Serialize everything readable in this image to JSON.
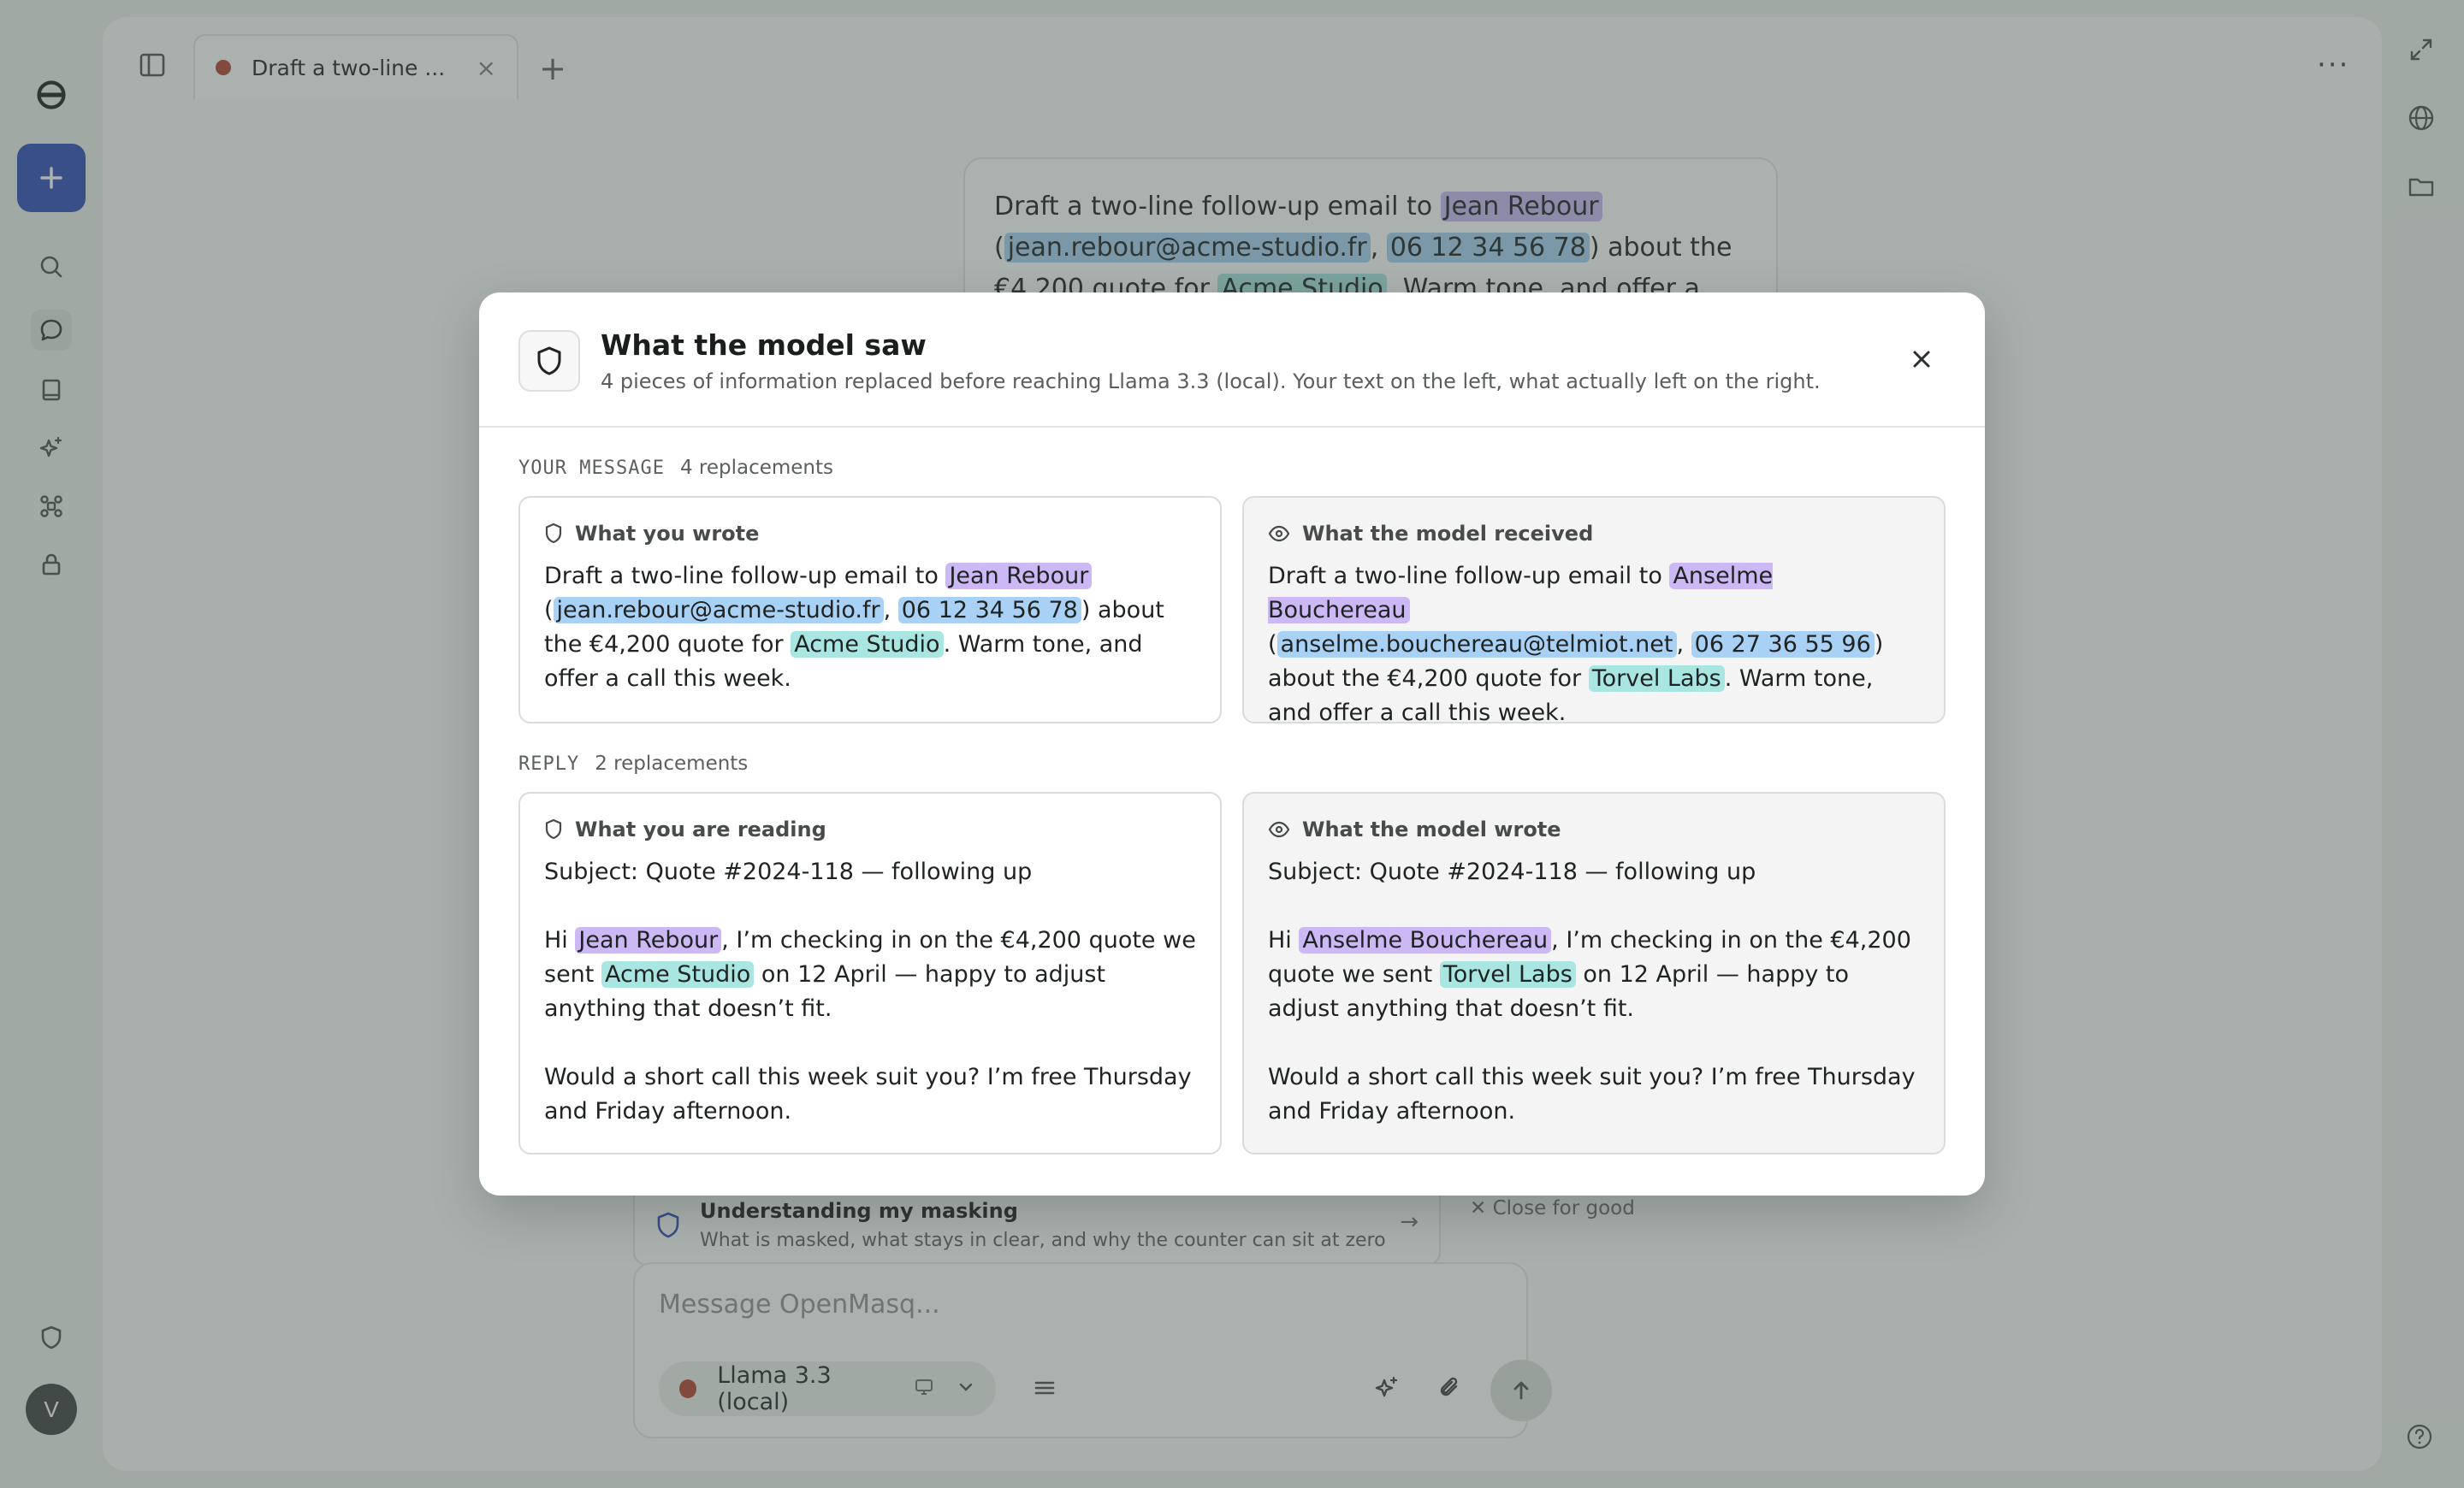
{
  "app": {
    "tab": {
      "title": "Draft a two-line ...",
      "close": "×"
    },
    "add_tab": "+",
    "more": "···",
    "avatar": "V"
  },
  "conversation": {
    "user_message": {
      "t1": "Draft a two-line follow-up email to ",
      "name": "Jean Rebour",
      "t2": "(",
      "email": "jean.rebour@acme-studio.fr",
      "comma": ", ",
      "phone": "06 12 34 56 78",
      "t3": ") about the",
      "t4": "€4,200 quote for ",
      "org": "Acme Studio",
      "t5": ". Warm tone, and offer a call"
    }
  },
  "notice": {
    "title": "Understanding my masking",
    "subtitle": "What is masked, what stays in clear, and why the counter can sit at zero",
    "arrow": "→",
    "dismiss": "✕ Close for good"
  },
  "composer": {
    "placeholder": "Message OpenMasq...",
    "model": "Llama 3.3 (local)"
  },
  "modal": {
    "title": "What the model saw",
    "subtitle": "4 pieces of information replaced before reaching Llama 3.3 (local). Your text on the left, what actually left on the right.",
    "message_section": {
      "label": "YOUR MESSAGE",
      "count": "4 replacements"
    },
    "reply_section": {
      "label": "REPLY",
      "count": "2 replacements"
    },
    "you_wrote": {
      "heading": "What you wrote",
      "t1": "Draft a two-line follow-up email to ",
      "name": "Jean Rebour",
      "t2": "(",
      "email": "jean.rebour@acme-studio.fr",
      "comma": ", ",
      "phone": "06 12 34 56 78",
      "t3": ") about the €4,200 quote for ",
      "org": "Acme Studio",
      "t4": ". Warm tone, and offer a call this week."
    },
    "model_received": {
      "heading": "What the model received",
      "t1": "Draft a two-line follow-up email to ",
      "name": "Anselme Bouchereau",
      "t2": "(",
      "email": "anselme.bouchereau@telmiot.net",
      "comma": ", ",
      "phone": "06 27 36 55 96",
      "t3": ") about the €4,200 quote for ",
      "org": "Torvel Labs",
      "t4": ". Warm tone, and offer a call this week."
    },
    "you_reading": {
      "heading": "What you are reading",
      "subject": "Subject: Quote #2024-118 — following up",
      "hi": "Hi ",
      "name": "Jean Rebour",
      "t1": ", I’m checking in on the €4,200 quote we sent ",
      "org": "Acme Studio",
      "t2": " on 12 April — happy to adjust anything that doesn’t fit.",
      "closing": "Would a short call this week suit you? I’m free Thursday and Friday afternoon."
    },
    "model_wrote": {
      "heading": "What the model wrote",
      "subject": "Subject: Quote #2024-118 — following up",
      "hi": "Hi ",
      "name": "Anselme Bouchereau",
      "t1": ", I’m checking in on the €4,200 quote we sent ",
      "org": "Torvel Labs",
      "t2": " on 12 April — happy to adjust anything that doesn’t fit.",
      "closing": "Would a short call this week suit you? I’m free Thursday and Friday afternoon."
    }
  },
  "colors": {
    "accent": "#2f4bb8",
    "name_highlight": "#cbb8f5",
    "contact_highlight": "#a8d1f5",
    "org_highlight": "#a9e6e1"
  },
  "icons": {
    "rail": [
      "logo-icon",
      "plus-icon",
      "search-icon",
      "chat-icon",
      "book-icon",
      "sparkle-icon",
      "drone-icon",
      "lock-icon",
      "shield-icon"
    ],
    "right_rail": [
      "expand-icon",
      "globe-icon",
      "folder-icon",
      "help-icon"
    ]
  }
}
